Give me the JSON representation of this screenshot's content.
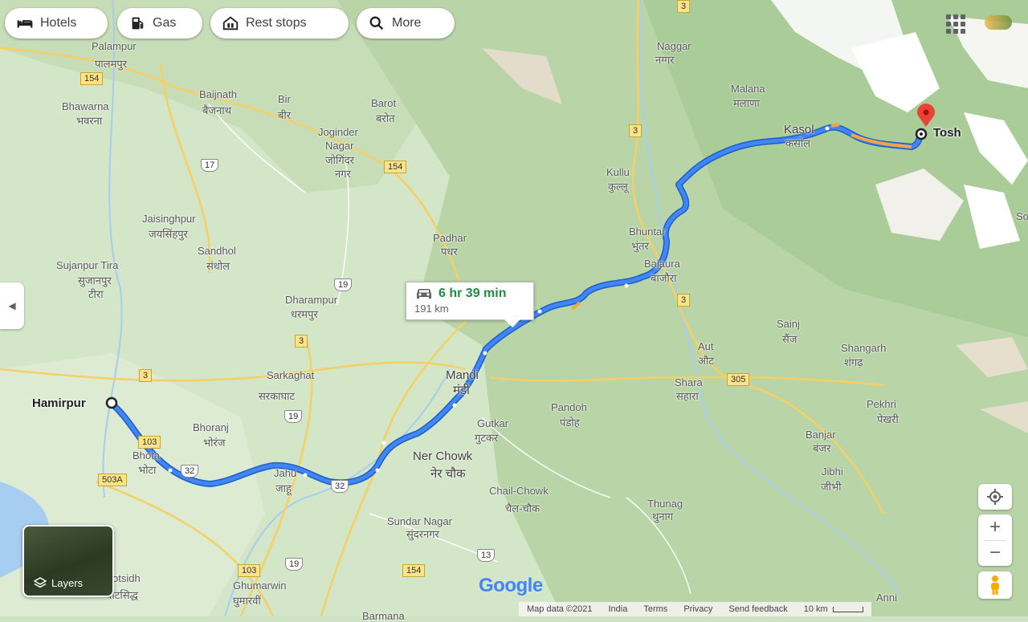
{
  "toolbar": {
    "hotels": "Hotels",
    "gas": "Gas",
    "rest_stops": "Rest stops",
    "more": "More"
  },
  "route": {
    "duration": "6 hr 39 min",
    "distance": "191 km",
    "origin": "Hamirpur",
    "destination": "Tosh",
    "color_primary": "#4285f4",
    "color_traffic": "#f4a442"
  },
  "places": [
    {
      "label": "Palampur"
    },
    {
      "label": "पालमपुर"
    },
    {
      "label": "Baijnath"
    },
    {
      "label": "बैजनाथ"
    },
    {
      "label": "Bir"
    },
    {
      "label": "बीर"
    },
    {
      "label": "Barot"
    },
    {
      "label": "बरोत"
    },
    {
      "label": "Bhawarna"
    },
    {
      "label": "भवरना"
    },
    {
      "label": "Joginder"
    },
    {
      "label": "Nagar"
    },
    {
      "label": "जोगिंदर"
    },
    {
      "label": "नगर"
    },
    {
      "label": "Naggar"
    },
    {
      "label": "नग्गर"
    },
    {
      "label": "Malana"
    },
    {
      "label": "मलाणा"
    },
    {
      "label": "Kasol"
    },
    {
      "label": "कसोल"
    },
    {
      "label": "Kullu"
    },
    {
      "label": "कुल्लू"
    },
    {
      "label": "Jaisinghpur"
    },
    {
      "label": "जयसिंहपुर"
    },
    {
      "label": "Sandhol"
    },
    {
      "label": "संधोल"
    },
    {
      "label": "Padhar"
    },
    {
      "label": "पधर"
    },
    {
      "label": "Bhuntar"
    },
    {
      "label": "भुंतर"
    },
    {
      "label": "Bajaura"
    },
    {
      "label": "बाजौरा"
    },
    {
      "label": "Sujanpur Tira"
    },
    {
      "label": "सुजानपुर"
    },
    {
      "label": "टीरा"
    },
    {
      "label": "Dharampur"
    },
    {
      "label": "धरमपुर"
    },
    {
      "label": "Sainj"
    },
    {
      "label": "सैंज"
    },
    {
      "label": "Aut"
    },
    {
      "label": "औट"
    },
    {
      "label": "Shangarh"
    },
    {
      "label": "शंगढ़"
    },
    {
      "label": "Mandi"
    },
    {
      "label": "मंडी"
    },
    {
      "label": "Sarkaghat"
    },
    {
      "label": "सरकाघाट"
    },
    {
      "label": "Shara"
    },
    {
      "label": "सहारा"
    },
    {
      "label": "Pandoh"
    },
    {
      "label": "पंडोह"
    },
    {
      "label": "Pekhri"
    },
    {
      "label": "पेखरी"
    },
    {
      "label": "Bhoranj"
    },
    {
      "label": "भोरंज"
    },
    {
      "label": "Gutkar"
    },
    {
      "label": "गुटकर"
    },
    {
      "label": "Banjar"
    },
    {
      "label": "बंजर"
    },
    {
      "label": "Bhota"
    },
    {
      "label": "भोटा"
    },
    {
      "label": "Ner Chowk"
    },
    {
      "label": "नेर चौक"
    },
    {
      "label": "Jibhi"
    },
    {
      "label": "जीभी"
    },
    {
      "label": "Chail-Chowk"
    },
    {
      "label": "चैल-चौक"
    },
    {
      "label": "Thunag"
    },
    {
      "label": "थुनाग"
    },
    {
      "label": "Sundar Nagar"
    },
    {
      "label": "सुंदरनगर"
    },
    {
      "label": "Ghumarwin"
    },
    {
      "label": "घुमारवीं"
    },
    {
      "label": "otsidh"
    },
    {
      "label": "बोटसिद्ध"
    },
    {
      "label": "Anni"
    },
    {
      "label": "Barmana"
    },
    {
      "label": "Jahu"
    },
    {
      "label": "जाहू"
    },
    {
      "label": "So"
    }
  ],
  "shields": [
    {
      "label": "154"
    },
    {
      "label": "17"
    },
    {
      "label": "154"
    },
    {
      "label": "3"
    },
    {
      "label": "3"
    },
    {
      "label": "19"
    },
    {
      "label": "3"
    },
    {
      "label": "3"
    },
    {
      "label": "3"
    },
    {
      "label": "305"
    },
    {
      "label": "19"
    },
    {
      "label": "103"
    },
    {
      "label": "32"
    },
    {
      "label": "32"
    },
    {
      "label": "503A"
    },
    {
      "label": "19"
    },
    {
      "label": "13"
    },
    {
      "label": "154"
    },
    {
      "label": "103"
    }
  ],
  "controls": {
    "layers": "Layers",
    "zoom_in": "+",
    "zoom_out": "−"
  },
  "footer": {
    "map_data": "Map data ©2021",
    "country": "India",
    "terms": "Terms",
    "privacy": "Privacy",
    "feedback": "Send feedback",
    "scale": "10 km"
  },
  "brand": "Google"
}
